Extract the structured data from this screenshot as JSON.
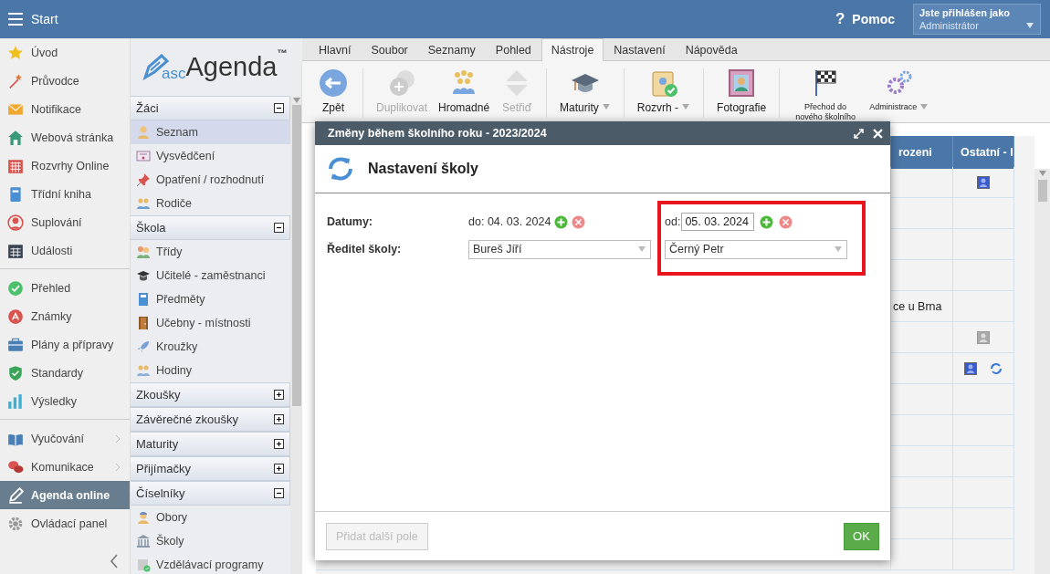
{
  "topbar": {
    "title": "Start",
    "help_mark": "?",
    "help_label": "Pomoc",
    "user_caption": "Jste přihlášen jako",
    "user_name": "Administrátor"
  },
  "nav": {
    "groups": [
      [
        {
          "label": "Úvod",
          "selected": false,
          "submenu": false
        },
        {
          "label": "Průvodce",
          "selected": false,
          "submenu": false
        },
        {
          "label": "Notifikace",
          "selected": false,
          "submenu": false
        },
        {
          "label": "Webová stránka",
          "selected": false,
          "submenu": false
        },
        {
          "label": "Rozvrhy Online",
          "selected": false,
          "submenu": false
        },
        {
          "label": "Třídní kniha",
          "selected": false,
          "submenu": false
        },
        {
          "label": "Suplování",
          "selected": false,
          "submenu": false
        },
        {
          "label": "Události",
          "selected": false,
          "submenu": false
        }
      ],
      [
        {
          "label": "Přehled",
          "selected": false,
          "submenu": false
        },
        {
          "label": "Známky",
          "selected": false,
          "submenu": false
        },
        {
          "label": "Plány a přípravy",
          "selected": false,
          "submenu": false
        },
        {
          "label": "Standardy",
          "selected": false,
          "submenu": false
        },
        {
          "label": "Výsledky",
          "selected": false,
          "submenu": false
        }
      ],
      [
        {
          "label": "Vyučování",
          "selected": false,
          "submenu": true
        },
        {
          "label": "Komunikace",
          "selected": false,
          "submenu": true
        },
        {
          "label": "Agenda online",
          "selected": true,
          "submenu": false
        },
        {
          "label": "Ovládací panel",
          "selected": false,
          "submenu": false
        }
      ]
    ]
  },
  "logo": {
    "prefix": "asc",
    "name": "Agenda",
    "mark": "™"
  },
  "sections": [
    {
      "title": "Žáci",
      "expanded": true,
      "items": [
        {
          "label": "Seznam",
          "selected": true
        },
        {
          "label": "Vysvědčení",
          "selected": false
        },
        {
          "label": "Opatření / rozhodnutí",
          "selected": false
        },
        {
          "label": "Rodiče",
          "selected": false
        }
      ]
    },
    {
      "title": "Škola",
      "expanded": true,
      "items": [
        {
          "label": "Třídy",
          "selected": false
        },
        {
          "label": "Učitelé - zaměstnanci",
          "selected": false
        },
        {
          "label": "Předměty",
          "selected": false
        },
        {
          "label": "Učebny - místnosti",
          "selected": false
        },
        {
          "label": "Kroužky",
          "selected": false
        },
        {
          "label": "Hodiny",
          "selected": false
        }
      ]
    },
    {
      "title": "Zkoušky",
      "expanded": false
    },
    {
      "title": "Závěrečné zkoušky",
      "expanded": false
    },
    {
      "title": "Maturity",
      "expanded": false
    },
    {
      "title": "Přijímačky",
      "expanded": false
    },
    {
      "title": "Číselníky",
      "expanded": true,
      "items": [
        {
          "label": "Obory",
          "selected": false
        },
        {
          "label": "Školy",
          "selected": false
        },
        {
          "label": "Vzdělávací programy",
          "selected": false
        }
      ]
    }
  ],
  "ribbon": {
    "tabs": [
      {
        "label": "Hlavní",
        "selected": false
      },
      {
        "label": "Soubor",
        "selected": false
      },
      {
        "label": "Seznamy",
        "selected": false
      },
      {
        "label": "Pohled",
        "selected": false
      },
      {
        "label": "Nástroje",
        "selected": true
      },
      {
        "label": "Nastavení",
        "selected": false
      },
      {
        "label": "Nápověda",
        "selected": false
      }
    ],
    "groups": [
      [
        {
          "label": "Zpět",
          "disabled": false,
          "dropdown": false,
          "kind": "large"
        }
      ],
      [
        {
          "label": "Duplikovat",
          "disabled": true,
          "dropdown": false,
          "kind": "large"
        },
        {
          "label": "Hromadné",
          "disabled": false,
          "dropdown": false,
          "kind": "large"
        },
        {
          "label": "Setřiď",
          "disabled": true,
          "dropdown": false,
          "kind": "large"
        }
      ],
      [
        {
          "label": "Maturity",
          "disabled": false,
          "dropdown": true,
          "kind": "large"
        }
      ],
      [
        {
          "label": "Rozvrh -",
          "disabled": false,
          "dropdown": true,
          "kind": "large"
        }
      ],
      [
        {
          "label": "Fotografie",
          "disabled": false,
          "dropdown": false,
          "kind": "large"
        }
      ],
      [
        {
          "label": "Přechod do nového školního",
          "disabled": false,
          "dropdown": false,
          "kind": "small"
        },
        {
          "label": "Administrace",
          "disabled": false,
          "dropdown": true,
          "kind": "small"
        }
      ]
    ]
  },
  "table": {
    "columns": [
      "rozeni",
      "Ostatní - I"
    ],
    "rows": [
      {
        "card": true,
        "card_active": true,
        "sync": false
      },
      {
        "card": false,
        "sync": false
      },
      {
        "card": false,
        "sync": false
      },
      {
        "card": false,
        "sync": false
      },
      {
        "column_1": "ce u Brna",
        "card": false,
        "sync": false
      },
      {
        "card": true,
        "card_active": false,
        "sync": false
      },
      {
        "card": true,
        "card_active": true,
        "sync": true
      },
      {
        "card": false,
        "sync": false
      },
      {
        "card": false,
        "sync": false
      },
      {
        "card": false,
        "sync": false
      },
      {
        "card": false,
        "sync": false
      },
      {
        "card": false,
        "sync": false
      },
      {
        "card": false,
        "sync": false
      }
    ]
  },
  "dialog": {
    "title": "Změny během školního roku - 2023/2024",
    "heading": "Nastavení školy",
    "rows": [
      {
        "label": "Datumy:",
        "kind": "dates",
        "cells": [
          {
            "kind": "text",
            "prefix": "do:",
            "value": "04. 03. 2024"
          },
          {
            "kind": "input",
            "prefix": "od:",
            "value": "05. 03. 2024"
          }
        ]
      },
      {
        "label": "Ředitel školy:",
        "kind": "select",
        "cells": [
          {
            "kind": "select",
            "value": "Bureš Jíří"
          },
          {
            "kind": "select",
            "value": "Černý Petr"
          }
        ]
      }
    ],
    "add_button": {
      "label": "Přidat další pole",
      "disabled": true
    },
    "ok_label": "OK"
  }
}
